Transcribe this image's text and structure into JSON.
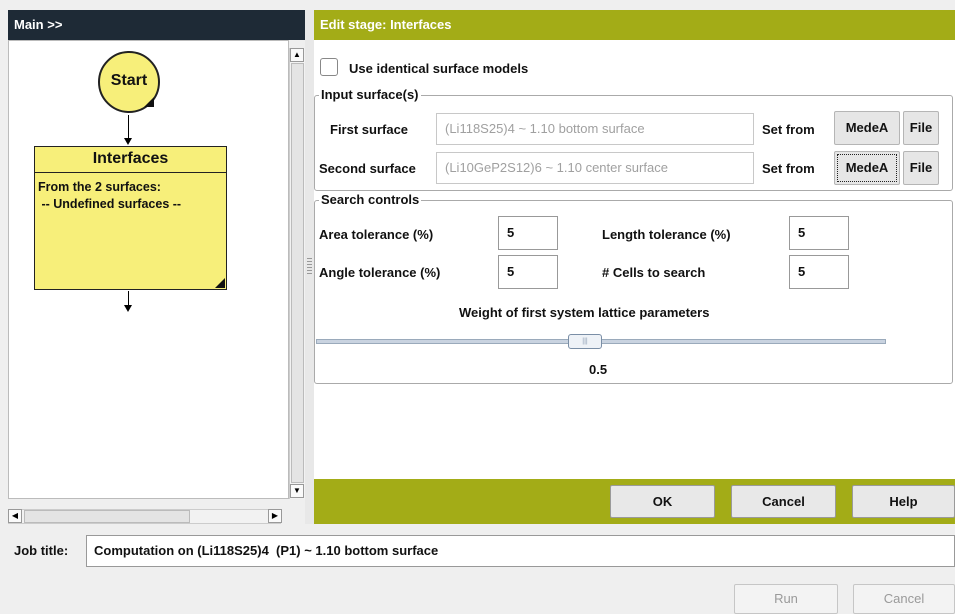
{
  "left_panel": {
    "title": "Main >>",
    "flow": {
      "start_label": "Start",
      "stage_title": "Interfaces",
      "stage_lines": [
        "From the 2 surfaces:",
        " -- Undefined surfaces --"
      ]
    }
  },
  "dialog": {
    "title": "Edit stage: Interfaces",
    "identical_checkbox_label": "Use identical surface models",
    "identical_checked": false,
    "input_group": {
      "legend": "Input surface(s)",
      "rows": [
        {
          "label": "First surface",
          "value": "(Li118S25)4 ~ 1.10 bottom surface",
          "set_from": "Set from",
          "medea": "MedeA",
          "file": "File"
        },
        {
          "label": "Second surface",
          "value": "(Li10GeP2S12)6 ~ 1.10 center surface",
          "set_from": "Set from",
          "medea": "MedeA",
          "file": "File"
        }
      ]
    },
    "search_group": {
      "legend": "Search controls",
      "area_label": "Area tolerance (%)",
      "area_value": "5",
      "length_label": "Length tolerance (%)",
      "length_value": "5",
      "angle_label": "Angle tolerance (%)",
      "angle_value": "5",
      "cells_label": "# Cells to search",
      "cells_value": "5",
      "weight_label": "Weight of first system lattice parameters",
      "weight_value": "0.5",
      "weight_fraction": 0.5
    },
    "buttons": {
      "ok": "OK",
      "cancel": "Cancel",
      "help": "Help"
    }
  },
  "job": {
    "label": "Job title:",
    "value": "Computation on (Li118S25)4  (P1) ~ 1.10 bottom surface"
  },
  "footer": {
    "run": "Run",
    "cancel": "Cancel"
  }
}
